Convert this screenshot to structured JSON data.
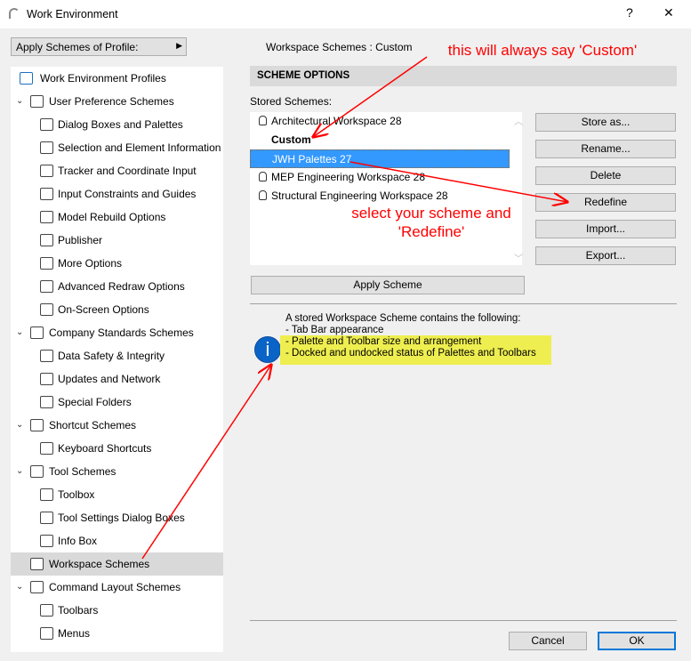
{
  "window": {
    "title": "Work Environment",
    "help": "?",
    "close": "✕"
  },
  "apply_profile": {
    "label": "Apply Schemes of Profile:"
  },
  "workspace_status": {
    "label": "Workspace Schemes :",
    "value": "Custom"
  },
  "tree": [
    {
      "label": "Work Environment Profiles",
      "level": 0,
      "icon": "profiles-icon"
    },
    {
      "label": "User Preference Schemes",
      "level": 1,
      "icon": "user-preference-icon",
      "expanded": true
    },
    {
      "label": "Dialog Boxes and Palettes",
      "level": 2,
      "icon": "dialog-boxes-icon"
    },
    {
      "label": "Selection and Element Information",
      "level": 2,
      "icon": "selection-icon"
    },
    {
      "label": "Tracker and Coordinate Input",
      "level": 2,
      "icon": "tracker-icon"
    },
    {
      "label": "Input Constraints and Guides",
      "level": 2,
      "icon": "input-constraints-icon"
    },
    {
      "label": "Model Rebuild Options",
      "level": 2,
      "icon": "model-rebuild-icon"
    },
    {
      "label": "Publisher",
      "level": 2,
      "icon": "publisher-icon"
    },
    {
      "label": "More Options",
      "level": 2,
      "icon": "more-options-icon"
    },
    {
      "label": "Advanced Redraw Options",
      "level": 2,
      "icon": "redraw-icon"
    },
    {
      "label": "On-Screen Options",
      "level": 2,
      "icon": "on-screen-icon"
    },
    {
      "label": "Company Standards Schemes",
      "level": 1,
      "icon": "company-standards-icon",
      "expanded": true
    },
    {
      "label": "Data Safety & Integrity",
      "level": 2,
      "icon": "data-safety-icon"
    },
    {
      "label": "Updates and Network",
      "level": 2,
      "icon": "network-icon"
    },
    {
      "label": "Special Folders",
      "level": 2,
      "icon": "folders-icon"
    },
    {
      "label": "Shortcut Schemes",
      "level": 1,
      "icon": "shortcut-icon",
      "expanded": true
    },
    {
      "label": "Keyboard Shortcuts",
      "level": 2,
      "icon": "keyboard-icon"
    },
    {
      "label": "Tool Schemes",
      "level": 1,
      "icon": "tool-schemes-icon",
      "expanded": true
    },
    {
      "label": "Toolbox",
      "level": 2,
      "icon": "toolbox-icon"
    },
    {
      "label": "Tool Settings Dialog Boxes",
      "level": 2,
      "icon": "tool-settings-icon"
    },
    {
      "label": "Info Box",
      "level": 2,
      "icon": "info-box-icon"
    },
    {
      "label": "Workspace Schemes",
      "level": 1,
      "icon": "workspace-icon",
      "selected": true
    },
    {
      "label": "Command Layout Schemes",
      "level": 1,
      "icon": "command-layout-icon",
      "expanded": true
    },
    {
      "label": "Toolbars",
      "level": 2,
      "icon": "toolbars-icon"
    },
    {
      "label": "Menus",
      "level": 2,
      "icon": "menus-icon"
    }
  ],
  "scheme_options": {
    "header": "SCHEME OPTIONS",
    "stored_label": "Stored Schemes:",
    "schemes": [
      {
        "label": "Architectural Workspace 28",
        "locked": true
      },
      {
        "label": "Custom",
        "bold": true
      },
      {
        "label": "JWH Palettes 27",
        "selected": true
      },
      {
        "label": "MEP Engineering Workspace 28",
        "locked": true
      },
      {
        "label": "Structural Engineering Workspace 28",
        "locked": true
      }
    ],
    "buttons": [
      "Store as...",
      "Rename...",
      "Delete",
      "Redefine",
      "Import...",
      "Export..."
    ],
    "apply": "Apply Scheme",
    "description": [
      "A stored Workspace Scheme contains the following:",
      "- Tab Bar appearance",
      "- Palette and Toolbar size and arrangement",
      "- Docked and undocked status of Palettes and Toolbars"
    ]
  },
  "footer": {
    "cancel": "Cancel",
    "ok": "OK"
  },
  "annotations": {
    "custom_note": "this will always say 'Custom'",
    "redefine_note_1": "select your scheme and",
    "redefine_note_2": "'Redefine'",
    "color": "#ff0000",
    "highlight": "#eeee50"
  }
}
